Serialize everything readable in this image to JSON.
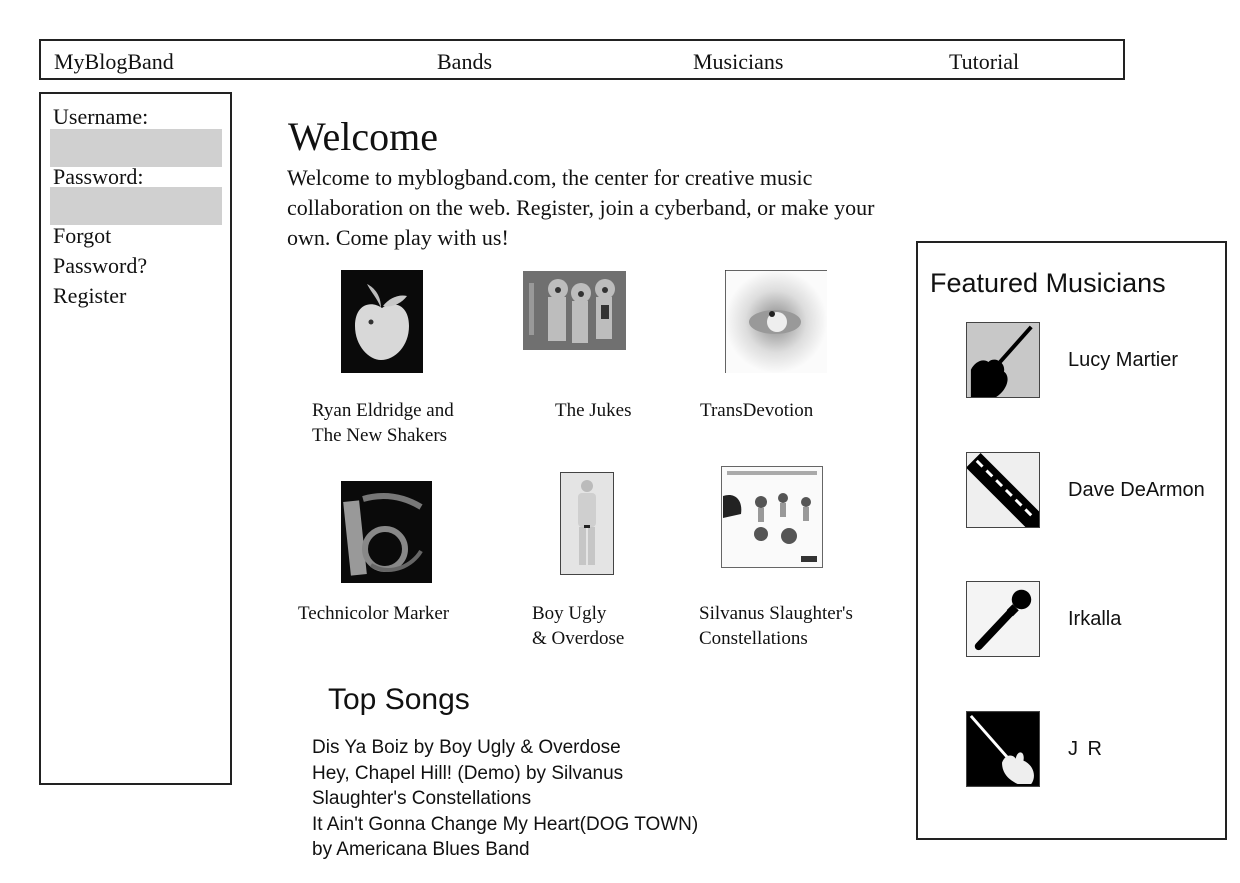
{
  "nav": {
    "brand": "MyBlogBand",
    "items": [
      {
        "label": "Bands"
      },
      {
        "label": "Musicians"
      },
      {
        "label": "Tutorial"
      }
    ]
  },
  "login": {
    "username_label": "Username:",
    "username_value": "",
    "password_label": "Password:",
    "password_value": "",
    "forgot_line1": "Forgot",
    "forgot_line2": "Password?",
    "register": "Register"
  },
  "welcome": {
    "title": "Welcome",
    "text": "Welcome to myblogband.com, the center for creative music collaboration on the web. Register, join a cyberband, or make your own. Come play with us!"
  },
  "bands": [
    {
      "name": "Ryan Eldridge and\nThe New Shakers",
      "image": "apple-photo"
    },
    {
      "name": "The Jukes",
      "image": "band-drawing-photo"
    },
    {
      "name": "TransDevotion",
      "image": "eye-photo"
    },
    {
      "name": "Technicolor Marker",
      "image": "abstract-swirl-photo"
    },
    {
      "name": "Boy Ugly\n& Overdose",
      "image": "standing-person-photo"
    },
    {
      "name": "Silvanus Slaughter's\nConstellations",
      "image": "album-cover-photo"
    }
  ],
  "top_songs": {
    "title": "Top Songs",
    "lines": [
      "Dis Ya Boiz by Boy Ugly & Overdose",
      "Hey, Chapel Hill! (Demo) by Silvanus",
      "Slaughter's Constellations",
      "It Ain't Gonna Change My Heart(DOG TOWN)",
      "by Americana Blues Band"
    ]
  },
  "featured": {
    "title": "Featured Musicians",
    "musicians": [
      {
        "name": "Lucy Martier",
        "icon": "acoustic-guitar-icon"
      },
      {
        "name": "Dave DeArmon",
        "icon": "keyboard-icon"
      },
      {
        "name": "Irkalla",
        "icon": "microphone-icon"
      },
      {
        "name": "J R",
        "icon": "electric-guitar-icon"
      }
    ]
  }
}
